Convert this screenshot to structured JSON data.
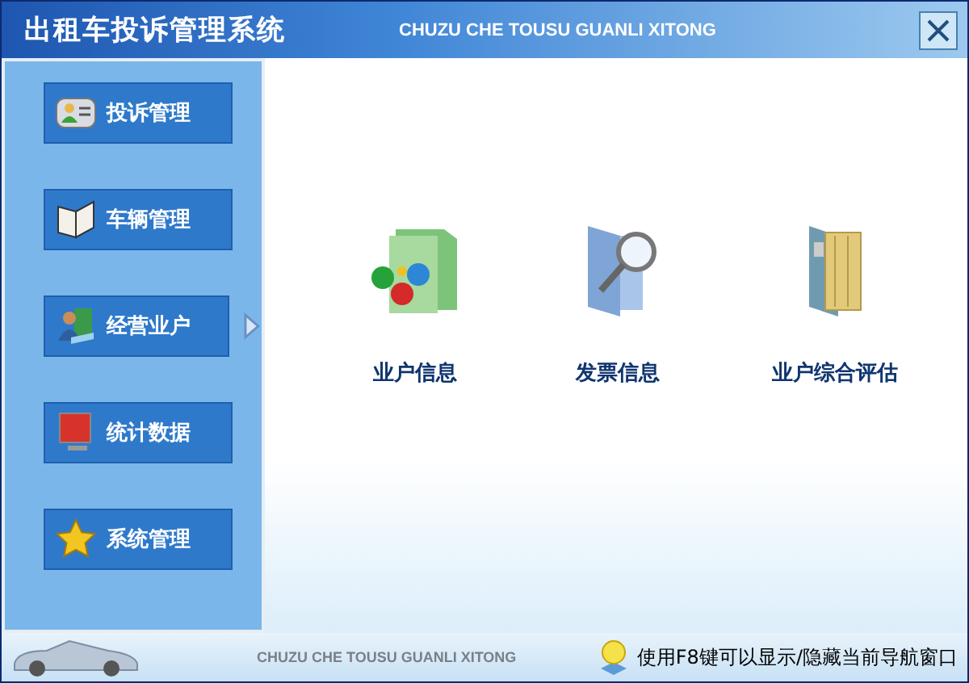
{
  "window": {
    "title": "出租车投诉管理系统",
    "subtitle": "CHUZU CHE TOUSU GUANLI XITONG"
  },
  "sidebar": {
    "items": [
      {
        "label": "投诉管理",
        "kind": "contacts",
        "selected": false
      },
      {
        "label": "车辆管理",
        "kind": "book",
        "selected": false
      },
      {
        "label": "经营业户",
        "kind": "user",
        "selected": true
      },
      {
        "label": "统计数据",
        "kind": "monitor",
        "selected": false
      },
      {
        "label": "系统管理",
        "kind": "star",
        "selected": false
      }
    ]
  },
  "content": {
    "items": [
      {
        "label": "业户信息",
        "kind": "people"
      },
      {
        "label": "发票信息",
        "kind": "search"
      },
      {
        "label": "业户综合评估",
        "kind": "files"
      }
    ]
  },
  "status_bar": {
    "brand": "CHUZU CHE TOUSU GUANLI XITONG",
    "hint": "使用F8键可以显示/隐藏当前导航窗口"
  }
}
